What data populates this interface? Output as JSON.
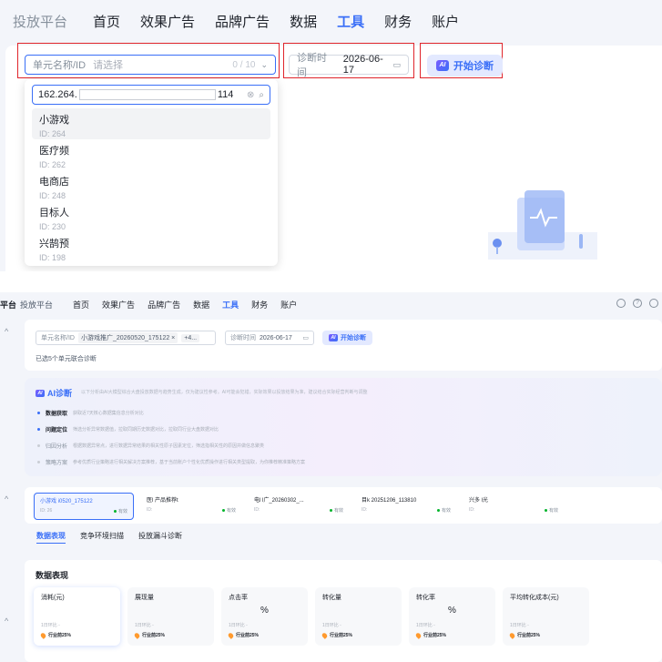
{
  "top": {
    "brand": "投放平台",
    "nav": [
      "首页",
      "效果广告",
      "品牌广告",
      "数据",
      "工具",
      "财务",
      "账户"
    ],
    "active_nav": "工具",
    "unit_field": {
      "label": "单元名称/ID",
      "placeholder": "请选择",
      "count": "0 / 10"
    },
    "diag_time": {
      "label": "诊断时间",
      "value": "2026-06-17"
    },
    "ai_button": "开始诊断",
    "ai_logo": "AI",
    "search": {
      "prefix": "162.264.",
      "suffix": "114"
    },
    "options": [
      {
        "name": "小游戏",
        "id": "ID: 264"
      },
      {
        "name": "医疗频",
        "id": "ID: 262"
      },
      {
        "name": "电商店",
        "id": "ID: 248"
      },
      {
        "name": "目标人",
        "id": "ID: 230"
      },
      {
        "name": "兴鹄预",
        "id": "ID: 198"
      }
    ]
  },
  "bottom": {
    "brand": "平台",
    "brand2": "投放平台",
    "nav": [
      "首页",
      "效果广告",
      "品牌广告",
      "数据",
      "工具",
      "财务",
      "账户"
    ],
    "active_nav": "工具",
    "unit_field": {
      "label": "单元名称/ID",
      "tag": "小游戏推广_20260520_175122 ×",
      "more": "+4..."
    },
    "diag_time": {
      "label": "诊断时间",
      "value": "2026-06-17"
    },
    "ai_button": "开始诊断",
    "selected_note": "已选5个单元联合诊断",
    "ai_card": {
      "title": "AI诊断",
      "desc": "以下分析由AI大模型综合大盘投放数据与趋势生成，仅为建议性参考。AI可能会犯错，实际效果以投放结果为准，建议结合实际经营判断与调整",
      "steps": [
        {
          "name": "数据获取",
          "desc": "获取近7天核心数据集信息分析对比"
        },
        {
          "name": "问题定位",
          "desc": "筛选分析异常数据值，拉取同期历史数据对比，拉取同行业大盘数据对比"
        },
        {
          "name": "归因分析",
          "desc": "根据数据异常点，进行数据异常结果的相关性原子因素定位，筛选指相关性的原因并做信息聚类"
        },
        {
          "name": "策略方案",
          "desc": "参考优质行业策略进行相关解决方案推荐，基于当前账户个性化优质操作进行相关类型提取，为你推荐精准策略方案"
        }
      ]
    },
    "units": [
      {
        "name": "小游戏     i0520_175122",
        "id": "ID: 26",
        "status": "有效"
      },
      {
        "name": "医l           产品推荐t",
        "id": "ID:",
        "status": "有效"
      },
      {
        "name": "电l           l广_20260302_...",
        "id": "ID:",
        "status": "有效"
      },
      {
        "name": "目k           20251206_113810",
        "id": "ID:",
        "status": "有效"
      },
      {
        "name": "兴多           l光",
        "id": "ID:",
        "status": "有效"
      }
    ],
    "tabs": [
      "数据表现",
      "竞争环境扫描",
      "投放漏斗诊断"
    ],
    "perf_title": "数据表现",
    "metrics": [
      {
        "name": "消耗(元)",
        "value": "",
        "compare": "1日环比  -",
        "tag": "行业前25%"
      },
      {
        "name": "展现量",
        "value": "",
        "compare": "1日环比  -",
        "tag": "行业前25%"
      },
      {
        "name": "点击率",
        "value": "%",
        "compare": "1日环比  -",
        "tag": "行业前25%"
      },
      {
        "name": "转化量",
        "value": "",
        "compare": "1日环比  -",
        "tag": "行业前25%"
      },
      {
        "name": "转化率",
        "value": "%",
        "compare": "1日环比  -",
        "tag": "行业前25%"
      },
      {
        "name": "平均转化成本(元)",
        "value": "",
        "compare": "1日环比  -",
        "tag": "行业前25%"
      }
    ],
    "collapse_icon": "^"
  },
  "colors": {
    "accent": "#3a6ff7",
    "highlight_box": "#e0242b",
    "success": "#00b42a",
    "tag": "#ff9a2e"
  }
}
